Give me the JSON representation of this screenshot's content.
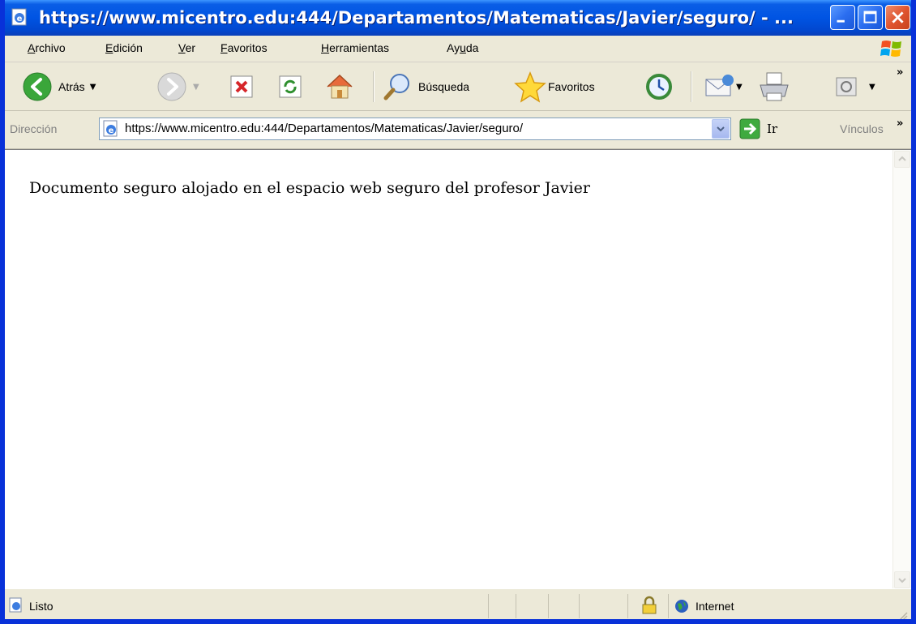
{
  "window": {
    "title": "https://www.micentro.edu:444/Departamentos/Matematicas/Javier/seguro/ - ..."
  },
  "menu": {
    "items": [
      {
        "label": "Archivo",
        "accel_index": 0
      },
      {
        "label": "Edición",
        "accel_index": 0
      },
      {
        "label": "Ver",
        "accel_index": 0
      },
      {
        "label": "Favoritos",
        "accel_index": 0
      },
      {
        "label": "Herramientas",
        "accel_index": 0
      },
      {
        "label": "Ayuda",
        "accel_index": 2
      }
    ]
  },
  "toolbar": {
    "back_label": "Atrás",
    "search_label": "Búsqueda",
    "favorites_label": "Favoritos"
  },
  "address": {
    "label": "Dirección",
    "url": "https://www.micentro.edu:444/Departamentos/Matematicas/Javier/seguro/",
    "go_label": "Ir",
    "links_label": "Vínculos"
  },
  "content": {
    "text": "Documento seguro alojado en el espacio web seguro del profesor Javier"
  },
  "status": {
    "text": "Listo",
    "zone": "Internet"
  },
  "colors": {
    "titlebar": "#0054e3",
    "chrome": "#ece9d8",
    "back_arrow": "#3aa63a"
  }
}
